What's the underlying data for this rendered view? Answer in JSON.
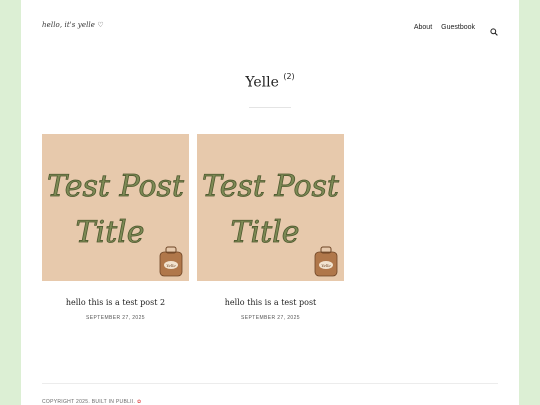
{
  "site": {
    "logo_text": "hello, it's yelle",
    "logo_heart": "♡"
  },
  "nav": {
    "items": [
      {
        "label": "About"
      },
      {
        "label": "Guestbook"
      }
    ],
    "search_icon": "search-icon"
  },
  "archive": {
    "title": "Yelle",
    "count": "(2)"
  },
  "posts": [
    {
      "thumb_line1": "Test Post",
      "thumb_line2": "Title",
      "thumb_tag": "Yelle",
      "title": "hello this is a test post 2",
      "date": "SEPTEMBER 27, 2025"
    },
    {
      "thumb_line1": "Test Post",
      "thumb_line2": "Title",
      "thumb_tag": "Yelle",
      "title": "hello this is a test post",
      "date": "SEPTEMBER 27, 2025"
    }
  ],
  "footer": {
    "text": "COPYRIGHT 2025. BUILT IN PUBLII.",
    "mark": "✿"
  },
  "colors": {
    "outer_bg": "#dcefd4",
    "thumb_bg": "#e7c9ac",
    "thumb_text": "#7d8a55",
    "tag_brown": "#b0774a"
  }
}
